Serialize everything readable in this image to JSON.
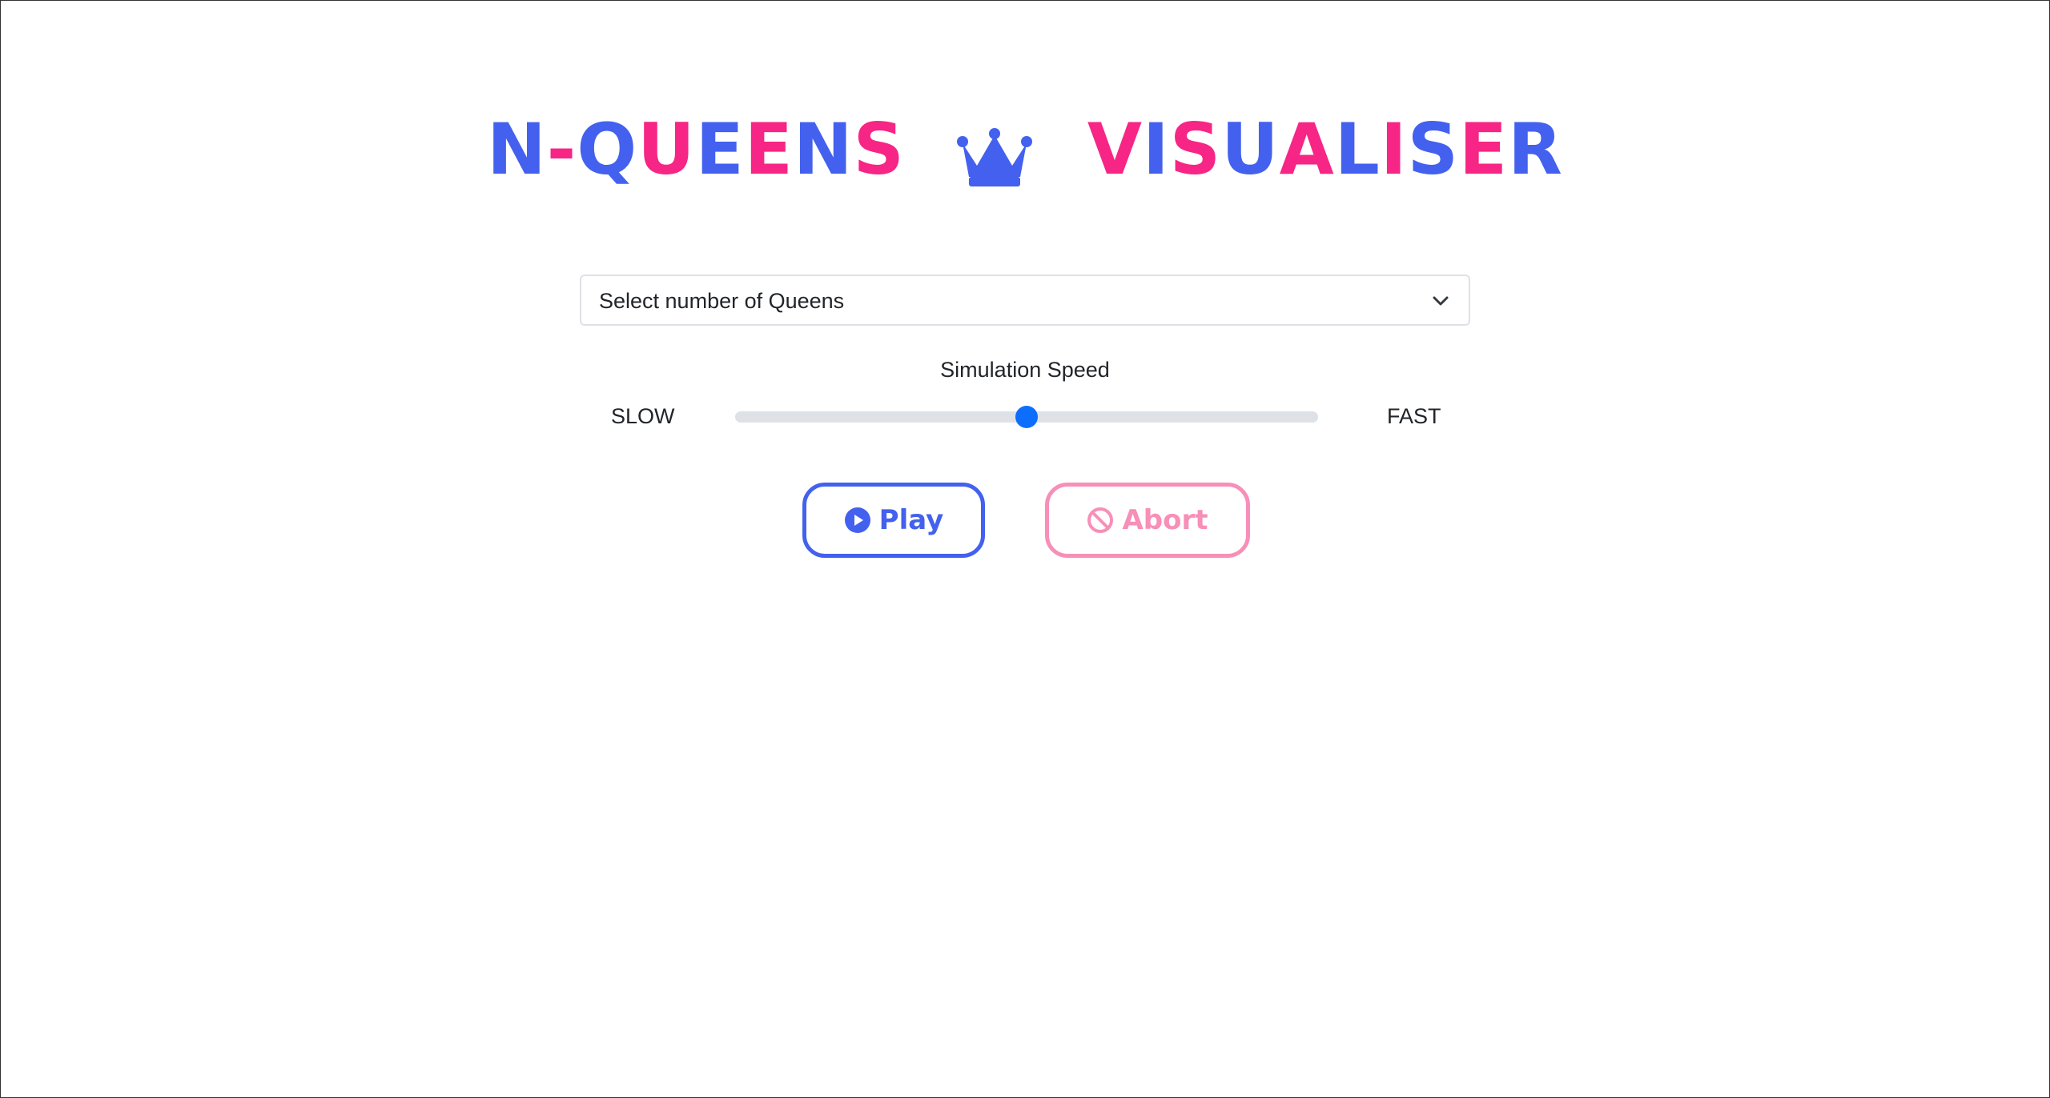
{
  "header": {
    "title_left": [
      {
        "ch": "N",
        "color": "#4361ee"
      },
      {
        "ch": "-",
        "color": "#f72585"
      },
      {
        "ch": "Q",
        "color": "#4361ee"
      },
      {
        "ch": "U",
        "color": "#f72585"
      },
      {
        "ch": "E",
        "color": "#4361ee"
      },
      {
        "ch": "E",
        "color": "#f72585"
      },
      {
        "ch": "N",
        "color": "#4361ee"
      },
      {
        "ch": "S",
        "color": "#f72585"
      }
    ],
    "title_right": [
      {
        "ch": "V",
        "color": "#f72585"
      },
      {
        "ch": "I",
        "color": "#4361ee"
      },
      {
        "ch": "S",
        "color": "#f72585"
      },
      {
        "ch": "U",
        "color": "#4361ee"
      },
      {
        "ch": "A",
        "color": "#f72585"
      },
      {
        "ch": "L",
        "color": "#4361ee"
      },
      {
        "ch": "I",
        "color": "#f72585"
      },
      {
        "ch": "S",
        "color": "#4361ee"
      },
      {
        "ch": "E",
        "color": "#f72585"
      },
      {
        "ch": "R",
        "color": "#4361ee"
      }
    ],
    "crown_icon": "crown-icon",
    "crown_color": "#4361ee"
  },
  "controls": {
    "queens_select": {
      "label": "Select number of Queens",
      "icon": "chevron-down-icon"
    },
    "speed": {
      "label": "Simulation Speed",
      "min_label": "SLOW",
      "max_label": "FAST",
      "value_fraction": 0.5,
      "accent": "#0d6efd"
    },
    "play_button": {
      "label": "Play",
      "icon": "play-circle-icon",
      "color": "#4361ee"
    },
    "abort_button": {
      "label": "Abort",
      "icon": "ban-icon",
      "color": "#f78fb8",
      "disabled": true
    }
  }
}
